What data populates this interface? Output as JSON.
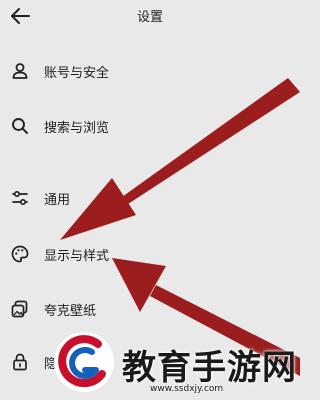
{
  "header": {
    "title": "设置"
  },
  "menu": {
    "items": [
      {
        "label": "账号与安全",
        "icon": "person-icon"
      },
      {
        "label": "搜索与浏览",
        "icon": "search-icon"
      },
      {
        "label": "通用",
        "icon": "sliders-icon"
      },
      {
        "label": "显示与样式",
        "icon": "palette-icon"
      },
      {
        "label": "夸克壁纸",
        "icon": "wallpaper-icon"
      },
      {
        "label": "隐",
        "icon": "lock-icon"
      }
    ]
  },
  "annotations": {
    "arrow_color": "#9b1d1d"
  },
  "watermark": {
    "name": "教育手游网",
    "url": "www.ssdxjy.com",
    "logo_colors": [
      "#c8102e",
      "#1560bd"
    ]
  }
}
